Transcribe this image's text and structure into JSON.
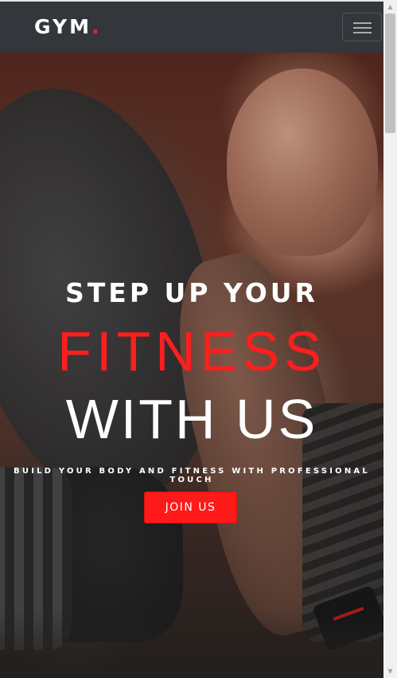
{
  "navbar": {
    "brand_text": "GYM",
    "brand_dot": ".",
    "menu_toggle": "hamburger-menu-icon"
  },
  "hero": {
    "heading_line1": "STEP UP YOUR",
    "heading_line2": "FITNESS",
    "heading_line3": "WITH US",
    "tagline": "BUILD YOUR BODY AND FITNESS WITH PROFESSIONAL TOUCH",
    "cta_label": "JOIN US",
    "background": "gym-athlete-photo"
  },
  "colors": {
    "accent": "#ff1e1e",
    "navbar_bg": "#33373b",
    "text_light": "#ffffff"
  },
  "scrollbar": {
    "up_icon": "scroll-up-arrow-icon",
    "down_icon": "scroll-down-arrow-icon"
  }
}
